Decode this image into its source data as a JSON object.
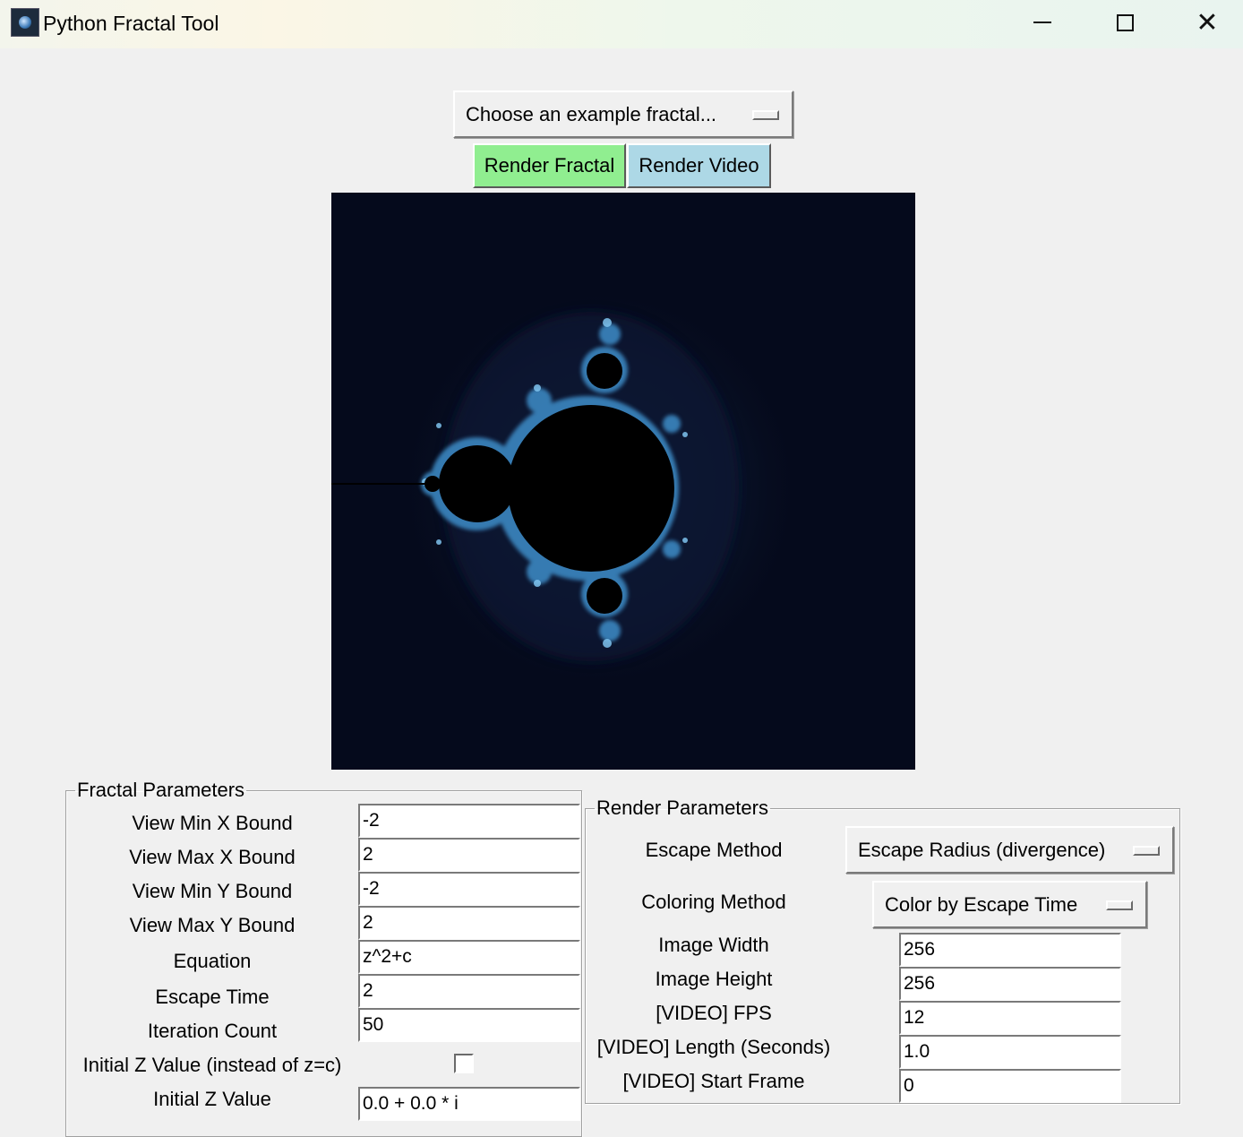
{
  "window": {
    "title": "Python Fractal Tool",
    "minimize_icon": "minimize-icon",
    "maximize_icon": "maximize-icon",
    "close_icon": "close-icon",
    "close_glyph": "✕"
  },
  "toolbar": {
    "example_menu": "Choose an example fractal...",
    "render_fractal": "Render Fractal",
    "render_video": "Render Video",
    "render_fractal_color": "#90ee90",
    "render_video_color": "#add8e6"
  },
  "fractal_params": {
    "legend": "Fractal Parameters",
    "rows": [
      {
        "label": "View Min X Bound",
        "value": "-2"
      },
      {
        "label": "View Max X Bound",
        "value": "2"
      },
      {
        "label": "View Min Y Bound",
        "value": "-2"
      },
      {
        "label": "View Max Y Bound",
        "value": "2"
      },
      {
        "label": "Equation",
        "value": "z^2+c"
      },
      {
        "label": "Escape Time",
        "value": "2"
      },
      {
        "label": "Iteration Count",
        "value": "50"
      }
    ],
    "initial_z_toggle_label": "Initial Z Value (instead of z=c)",
    "initial_z_toggle_checked": false,
    "initial_z_label": "Initial Z Value",
    "initial_z_value": "0.0 + 0.0 * i"
  },
  "render_params": {
    "legend": "Render Parameters",
    "escape_method_label": "Escape Method",
    "escape_method_value": "Escape Radius (divergence)",
    "coloring_method_label": "Coloring Method",
    "coloring_method_value": "Color by Escape Time",
    "rows": [
      {
        "label": "Image Width",
        "value": "256"
      },
      {
        "label": "Image Height",
        "value": "256"
      },
      {
        "label": "[VIDEO] FPS",
        "value": "12"
      },
      {
        "label": "[VIDEO] Length (Seconds)",
        "value": "1.0"
      },
      {
        "label": "[VIDEO] Start Frame",
        "value": "0"
      }
    ]
  },
  "fractal_image": {
    "description_icon": "mandelbrot-set-image",
    "background_color": "#050a1c",
    "edge_color": "#4a9ad0"
  }
}
